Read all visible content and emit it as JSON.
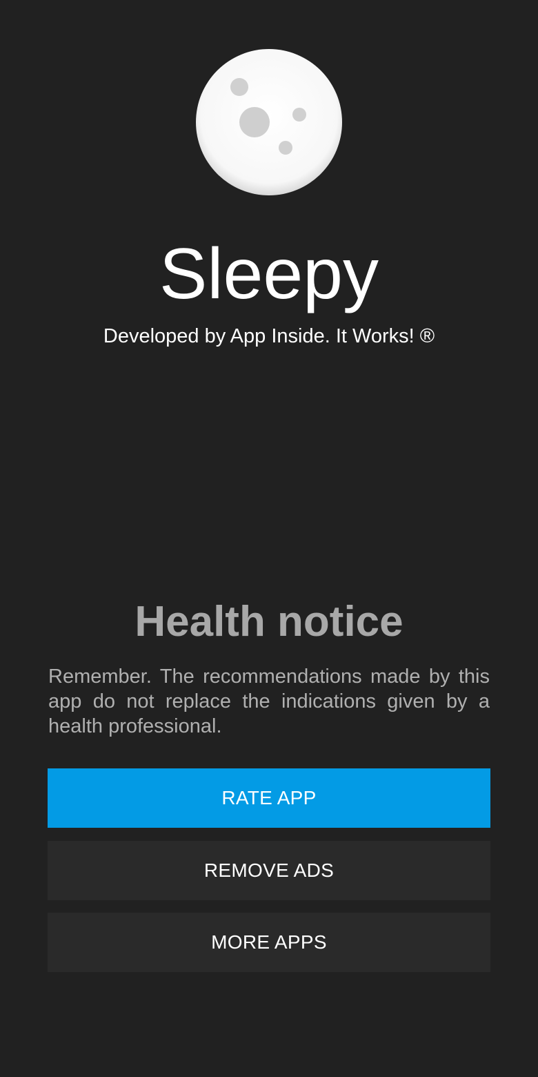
{
  "app": {
    "name": "Sleepy",
    "developer_line": "Developed by App Inside. It Works! ®",
    "logo_icon": "moon-icon"
  },
  "notice": {
    "title": "Health notice",
    "text": "Remember. The recommendations made by this app do not replace the indications given by a health professional."
  },
  "buttons": {
    "rate_app": "RATE APP",
    "remove_ads": "REMOVE ADS",
    "more_apps": "MORE APPS"
  },
  "colors": {
    "background": "#212121",
    "accent": "#039be5",
    "secondary_button": "#2a2a2a",
    "notice_title": "#a8a8a8"
  }
}
